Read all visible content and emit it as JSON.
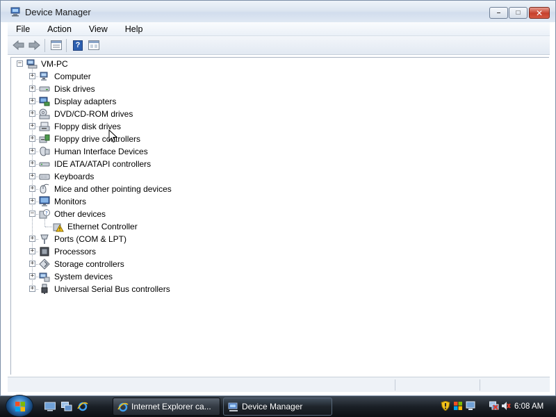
{
  "window": {
    "title": "Device Manager",
    "controls": {
      "minimize": "–",
      "maximize": "□",
      "close": "✕"
    }
  },
  "menu": [
    "File",
    "Action",
    "View",
    "Help"
  ],
  "toolbar": {
    "buttons": [
      "back-icon",
      "forward-icon",
      "properties-icon",
      "help-icon",
      "scan-icon"
    ],
    "help_glyph": "?"
  },
  "tree": {
    "root": "VM-PC",
    "categories": [
      {
        "label": "Computer",
        "icon": "computer-icon",
        "expanded": false
      },
      {
        "label": "Disk drives",
        "icon": "disk-drive-icon",
        "expanded": false
      },
      {
        "label": "Display adapters",
        "icon": "display-adapter-icon",
        "expanded": false
      },
      {
        "label": "DVD/CD-ROM drives",
        "icon": "dvd-drive-icon",
        "expanded": false
      },
      {
        "label": "Floppy disk drives",
        "icon": "floppy-icon",
        "expanded": false
      },
      {
        "label": "Floppy drive controllers",
        "icon": "floppy-controller-icon",
        "expanded": false
      },
      {
        "label": "Human Interface Devices",
        "icon": "hid-icon",
        "expanded": false
      },
      {
        "label": "IDE ATA/ATAPI controllers",
        "icon": "ide-controller-icon",
        "expanded": false
      },
      {
        "label": "Keyboards",
        "icon": "keyboard-icon",
        "expanded": false
      },
      {
        "label": "Mice and other pointing devices",
        "icon": "mouse-icon",
        "expanded": false
      },
      {
        "label": "Monitors",
        "icon": "monitor-icon",
        "expanded": false
      },
      {
        "label": "Other devices",
        "icon": "other-devices-icon",
        "expanded": true,
        "children": [
          {
            "label": "Ethernet Controller",
            "icon": "warning-device-icon"
          }
        ]
      },
      {
        "label": "Ports (COM & LPT)",
        "icon": "port-icon",
        "expanded": false
      },
      {
        "label": "Processors",
        "icon": "processor-icon",
        "expanded": false
      },
      {
        "label": "Storage controllers",
        "icon": "storage-controller-icon",
        "expanded": false
      },
      {
        "label": "System devices",
        "icon": "system-devices-icon",
        "expanded": false
      },
      {
        "label": "Universal Serial Bus controllers",
        "icon": "usb-icon",
        "expanded": false
      }
    ]
  },
  "expander_glyphs": {
    "collapsed": "+",
    "expanded": "−"
  },
  "taskbar": {
    "quick_launch": [
      "show-desktop-icon",
      "switch-windows-icon",
      "internet-explorer-icon"
    ],
    "tasks": [
      {
        "label": "Internet Explorer ca...",
        "icon": "internet-explorer-icon"
      },
      {
        "label": "Device Manager",
        "icon": "device-manager-icon"
      }
    ],
    "tray_icons": [
      "security-shield-icon",
      "windows-update-icon",
      "network-icon",
      "network-disconnected-icon",
      "volume-muted-icon"
    ],
    "clock": "6:08 AM"
  },
  "colors": {
    "accent": "#2c5fb0",
    "warning": "#f2c21a",
    "close_button": "#c6402c"
  }
}
